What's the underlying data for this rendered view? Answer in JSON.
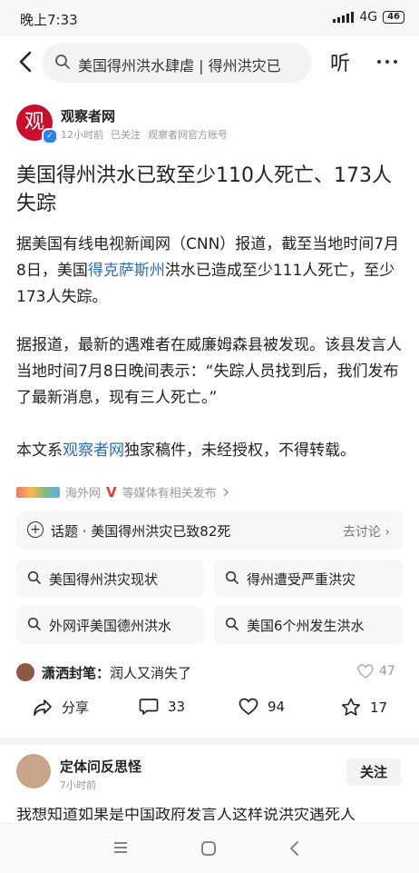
{
  "status": {
    "time": "晚上7:33",
    "network": "4G",
    "battery": "46"
  },
  "header": {
    "search_text": "美国得州洪水肆虐 | 得州洪灾已",
    "listen_label": "听"
  },
  "author": {
    "avatar_glyph": "观",
    "name": "观察者网",
    "time": "12小时前",
    "follow_state": "已关注",
    "account_desc": "观察者网官方账号"
  },
  "article": {
    "title": "美国得州洪水已致至少110人死亡、173人失踪",
    "p1_a": "据美国有线电视新闻网（CNN）报道，截至当地时间7月8日，美国",
    "p1_link": "得克萨斯州",
    "p1_b": "洪水已造成至少111人死亡，至少173人失踪。",
    "p2": "据报道，最新的遇难者在威廉姆森县被发现。该县发言人当地时间7月8日晚间表示：“失踪人员找到后，我们发布了最新消息，现有三人死亡。”",
    "p3_a": "本文系",
    "p3_link": "观察者网",
    "p3_b": "独家稿件，未经授权，不得转载。"
  },
  "source": {
    "outlet": "海外网",
    "v": "V",
    "more": "等媒体有相关发布"
  },
  "topic": {
    "label": "话题 · 美国得州洪灾已致82死",
    "action": "去讨论"
  },
  "related": [
    "美国得州洪灾现状",
    "得州遭受严重洪灾",
    "外网评美国德州洪水",
    "美国6个州发生洪水"
  ],
  "top_comment": {
    "user": "潇洒封笔：",
    "text": "润人又消失了",
    "likes": "47"
  },
  "actions": {
    "share": "分享",
    "comments": "33",
    "likes": "94",
    "favorites": "17"
  },
  "next_post": {
    "author": "定体问反思怪",
    "time": "7小时前",
    "follow": "关注",
    "preview": "我想知道如果是中国政府发言人这样说洪灾遇死人"
  },
  "colors": {
    "link": "#2f6db5",
    "brand_red": "#c8102e",
    "verified_blue": "#2f80ed"
  }
}
